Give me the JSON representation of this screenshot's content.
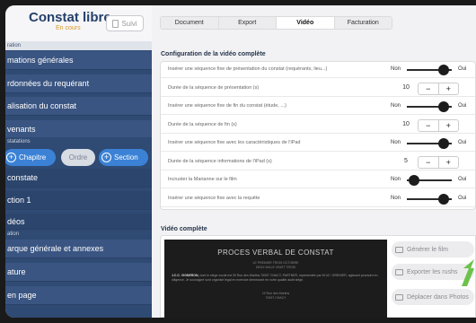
{
  "app": {
    "title": "Constat libre",
    "status": "En cours",
    "suivi_label": "Suivi"
  },
  "sidebar": {
    "section_caps": [
      "ration",
      "statations",
      "ation"
    ],
    "items": [
      "mations générales",
      "rdonnées du requérant",
      "alisation du constat",
      "venants",
      "constate",
      "ction 1",
      "déos",
      "arque générale et annexes",
      "ature",
      "en page"
    ],
    "segment": {
      "chapitre": "Chapitre",
      "ordre": "Ordre",
      "section": "Section"
    }
  },
  "tabs": [
    "Document",
    "Export",
    "Vidéo",
    "Facturation"
  ],
  "active_tab": "Vidéo",
  "config": {
    "title": "Configuration de la vidéo complète",
    "non": "Non",
    "oui": "Oui",
    "rows": [
      {
        "label": "Insérer une séquence fixe de présentation du constat (requérants, lieu...)",
        "kind": "toggle",
        "on": true
      },
      {
        "label": "Durée de la séquence de présentation (s)",
        "kind": "stepper",
        "value": "10"
      },
      {
        "label": "Insérer une séquence fixe de fin du constat (étude, ...)",
        "kind": "toggle",
        "on": true
      },
      {
        "label": "Durée de la séquence de fin (s)",
        "kind": "stepper",
        "value": "10"
      },
      {
        "label": "Insérer une séquence fixe avec les caractéristiques de l'iPad",
        "kind": "toggle",
        "on": true
      },
      {
        "label": "Durée de la séquence informations de l'iPad (s)",
        "kind": "stepper",
        "value": "5"
      },
      {
        "label": "Incruster la Marianne sur le film",
        "kind": "toggle",
        "on": false
      },
      {
        "label": "Insérer une séquence fixe avec la requête",
        "kind": "toggle",
        "on": true
      }
    ],
    "minus": "−",
    "plus": "+"
  },
  "video": {
    "title": "Vidéo complète",
    "frame_title": "PROCES VERBAL DE CONSTAT",
    "frame_sub1": "LE PREMIER TROIS OCTOBRE",
    "frame_sub2": "DEUX MILLE VINGT TROIS",
    "frame_lead": "J.C.C. VIGNERON,",
    "frame_para": "dont le siège social est 30 Rue des Martins 70097 CHACY, PARTNER, représentée par M LE / GRENIER, agissant poursuivi en diligence. Je soussigné sont organisé légal en exercice demeurant en notre qualité audit siège.",
    "frame_foot1": "10 Rue des Martins",
    "frame_foot2": "70097 CHACY",
    "actions": [
      "Générer le film",
      "Exporter les rushs",
      "Déplacer dans Photos"
    ]
  }
}
